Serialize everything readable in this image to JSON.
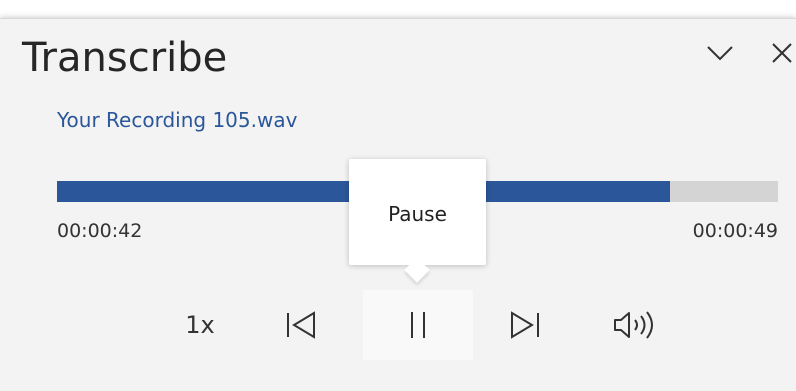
{
  "panel": {
    "title": "Transcribe",
    "collapse_icon": "chevron-down-icon",
    "close_icon": "close-icon"
  },
  "recording": {
    "filename": "Your Recording 105.wav",
    "progress_fraction": 0.85,
    "current_time": "00:00:42",
    "total_time": "00:00:49"
  },
  "tooltip": {
    "text": "Pause"
  },
  "controls": {
    "speed_label": "1x",
    "previous_icon": "skip-previous-icon",
    "pause_icon": "pause-icon",
    "next_icon": "skip-next-icon",
    "volume_icon": "volume-icon"
  },
  "colors": {
    "accent": "#2b579a",
    "track": "#d4d4d4",
    "pane_bg": "#f3f3f3"
  }
}
